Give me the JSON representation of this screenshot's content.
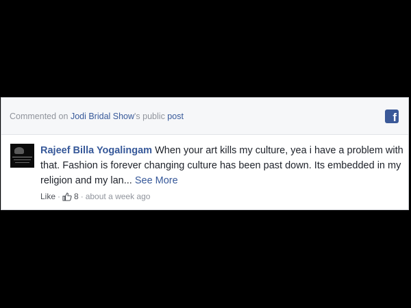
{
  "header": {
    "prefix": "Commented on ",
    "page_name": "Jodi Bridal Show",
    "possessive": "'s public ",
    "post_label": "post"
  },
  "logo_icon": "facebook-icon",
  "comment": {
    "author": "Rajeef Billa Yogalingam",
    "text": " When your art kills my culture, yea i have a problem with that. Fashion is forever changing culture has been past down. Its embedded in my religion and my lan... ",
    "see_more": "See More"
  },
  "actions": {
    "like_label": "Like",
    "separator": "·",
    "like_count": "8",
    "timestamp": "about a week ago"
  },
  "colors": {
    "link": "#365899",
    "meta": "#90949c",
    "text": "#1d2129",
    "facebook_blue": "#3b5998",
    "background": "#000000"
  }
}
